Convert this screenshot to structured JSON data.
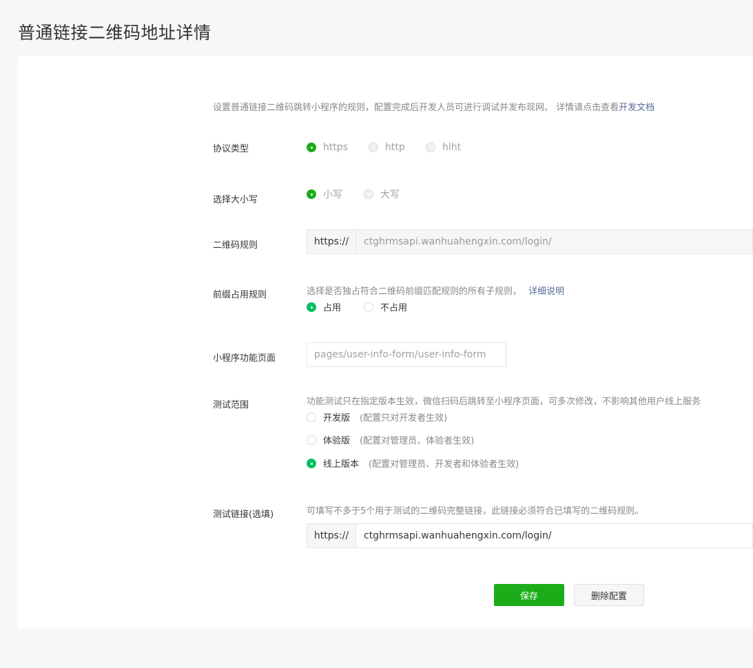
{
  "page": {
    "title": "普通链接二维码地址详情"
  },
  "intro": {
    "text": "设置普通链接二维码跳转小程序的规则，配置完成后开发人员可进行调试并发布现网。 详情请点击查看",
    "link": "开发文档"
  },
  "protocol": {
    "label": "协议类型",
    "options": [
      "https",
      "http",
      "hlht"
    ],
    "selected": "https"
  },
  "case": {
    "label": "选择大小写",
    "options": [
      "小写",
      "大写"
    ],
    "selected": "小写"
  },
  "qr_rule": {
    "label": "二维码规则",
    "prefix": "https://",
    "value": "ctghrmsapi.wanhuahengxin.com/login/"
  },
  "prefix_rule": {
    "label": "前缀占用规则",
    "hint": "选择是否独占符合二维码前缀匹配规则的所有子规则，",
    "link": "详细说明",
    "options": [
      "占用",
      "不占用"
    ],
    "selected": "占用"
  },
  "mini_page": {
    "label": "小程序功能页面",
    "placeholder": "pages/user-info-form/user-info-form"
  },
  "test_scope": {
    "label": "测试范围",
    "hint": "功能测试只在指定版本生效，微信扫码后跳转至小程序页面，可多次修改，不影响其他用户线上服务",
    "options": [
      {
        "name": "开发版",
        "desc": "(配置只对开发者生效)"
      },
      {
        "name": "体验版",
        "desc": "(配置对管理员、体验者生效)"
      },
      {
        "name": "线上版本",
        "desc": "(配置对管理员、开发者和体验者生效)"
      }
    ],
    "selected": "线上版本"
  },
  "test_link": {
    "label": "测试链接(选填)",
    "hint": "可填写不多于5个用于测试的二维码完整链接，此链接必须符合已填写的二维码规则。",
    "prefix": "https://",
    "value": "ctghrmsapi.wanhuahengxin.com/login/"
  },
  "actions": {
    "save": "保存",
    "delete": "删除配置"
  },
  "colors": {
    "primary": "#1aad19",
    "radio_on": "#07c160",
    "link": "#576b95"
  }
}
